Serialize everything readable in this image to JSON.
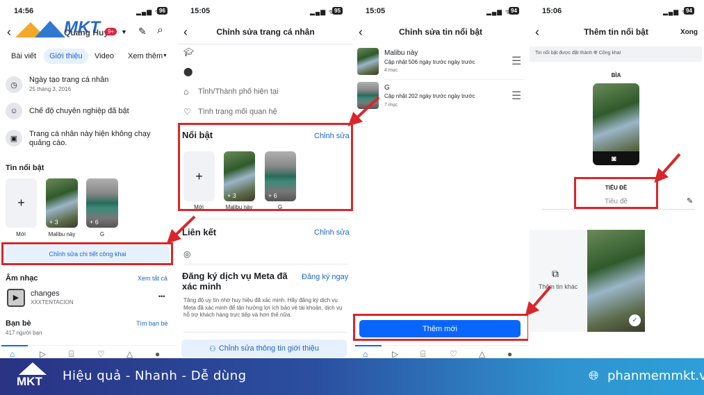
{
  "panel1": {
    "time": "14:56",
    "battery": "96",
    "profile_name": "Quang Huy",
    "notif_badge": "9+",
    "tabs": [
      "Bài viết",
      "Giới thiệu",
      "Video",
      "Xem thêm"
    ],
    "about": [
      {
        "title": "Ngày tạo trang cá nhân",
        "sub": "25 tháng 3, 2016",
        "icon": "clock-icon"
      },
      {
        "title": "Chế độ chuyên nghiệp đã bật",
        "icon": "professional-icon"
      },
      {
        "title": "Trang cá nhân này hiện không chạy",
        "title2": "quảng cáo.",
        "icon": "ads-icon"
      }
    ],
    "highlights_title": "Tin nổi bật",
    "highlights": [
      {
        "label": "Mới"
      },
      {
        "label": "Malibu này",
        "count": "+ 3"
      },
      {
        "label": "G",
        "count": "+ 6"
      }
    ],
    "edit_public_button": "Chỉnh sửa chi tiết công khai",
    "music_title": "Âm nhạc",
    "music_see_all": "Xem tất cả",
    "song": "changes",
    "artist": "XXXTENTACION",
    "more": "•••",
    "friends_title": "Bạn bè",
    "friends_count": "417 người bạn",
    "find_friends": "Tìm bạn bè"
  },
  "panel2": {
    "time": "15:05",
    "battery": "95",
    "title": "Chỉnh sửa trang cá nhân",
    "rows": [
      "Tỉnh/Thành phố hiện tại",
      "Tình trạng mối quan hệ"
    ],
    "featured_title": "Nổi bật",
    "featured_edit": "Chỉnh sửa",
    "highlights": [
      {
        "label": "Mới"
      },
      {
        "label": "Malibu này",
        "count": "+ 3"
      },
      {
        "label": "G",
        "count": "+ 6"
      }
    ],
    "links_title": "Liên kết",
    "links_edit": "Chỉnh sửa",
    "meta_title": "Đăng ký dịch vụ Meta đã xác minh",
    "meta_action": "Đăng ký ngay",
    "meta_desc": "Tăng độ uy tín nhờ huy hiệu đã xác minh. Hãy đăng ký dịch vụ Meta đã xác minh để tận hưởng lợi ích bảo vệ tài khoản, dịch vụ hỗ trợ khách hàng trực tiếp và hơn thế nữa.",
    "edit_intro_button": "Chỉnh sửa thông tin giới thiệu"
  },
  "panel3": {
    "time": "15:05",
    "battery": "94",
    "title": "Chỉnh sửa tin nổi bật",
    "items": [
      {
        "name": "Malibu này",
        "updated": "Cập nhật 506 ngày trước ngày trước",
        "count": "4 mục"
      },
      {
        "name": "G",
        "updated": "Cập nhật 202 ngày trước ngày trước",
        "count": "7 mục"
      }
    ],
    "add_button": "Thêm mới"
  },
  "panel4": {
    "time": "15:06",
    "battery": "94",
    "title": "Thêm tin nổi bật",
    "done": "Xong",
    "privacy_prefix": "Tin nổi bật được đặt thành",
    "privacy_value": "Công khai",
    "cover_label": "BÌA",
    "title_label": "TIÊU ĐỀ",
    "title_placeholder": "Tiêu đề",
    "add_more": "Thêm tin khác"
  },
  "banner": {
    "logo": "MKT",
    "slogan": "Hiệu quả - Nhanh  - Dễ dùng",
    "website": "phanmemmkt.vn"
  },
  "colors": {
    "accent": "#0866ff",
    "annotation_red": "#d9262a",
    "link_blue": "#1b66c9"
  }
}
